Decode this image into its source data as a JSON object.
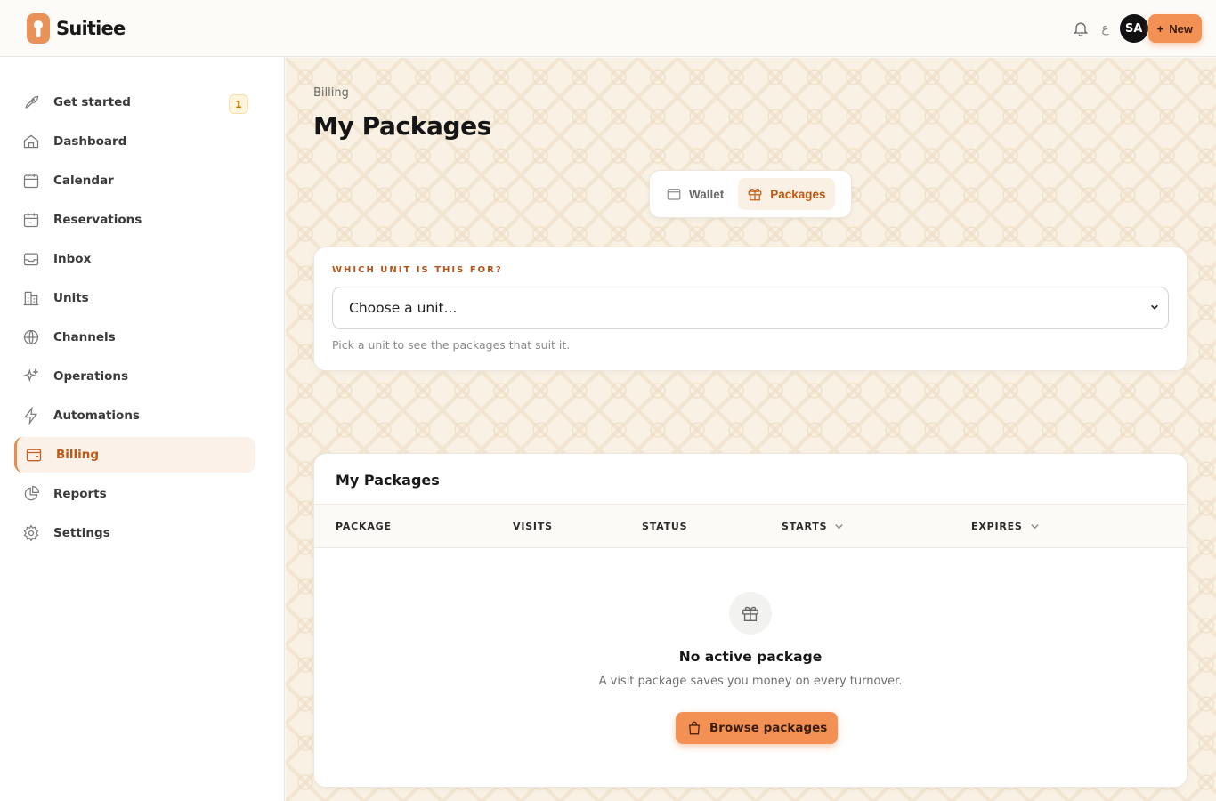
{
  "brand": {
    "name": "Suitiee",
    "accent": "#e8925a"
  },
  "header": {
    "lang_label": "ع",
    "avatar_initials": "SA",
    "new_label": "New"
  },
  "sidebar": {
    "items": [
      {
        "label": "Get started",
        "icon": "rocket-icon",
        "badge": "1"
      },
      {
        "label": "Dashboard",
        "icon": "home-icon"
      },
      {
        "label": "Calendar",
        "icon": "calendar-icon"
      },
      {
        "label": "Reservations",
        "icon": "reservations-icon"
      },
      {
        "label": "Inbox",
        "icon": "inbox-icon"
      },
      {
        "label": "Units",
        "icon": "building-icon"
      },
      {
        "label": "Channels",
        "icon": "globe-icon"
      },
      {
        "label": "Operations",
        "icon": "sparkles-icon"
      },
      {
        "label": "Automations",
        "icon": "bolt-icon"
      },
      {
        "label": "Billing",
        "icon": "wallet-icon",
        "active": true
      },
      {
        "label": "Reports",
        "icon": "pie-chart-icon"
      },
      {
        "label": "Settings",
        "icon": "gear-icon"
      }
    ]
  },
  "page": {
    "breadcrumb": "Billing",
    "title": "My Packages",
    "tabs": [
      {
        "label": "Wallet",
        "icon": "wallet-icon"
      },
      {
        "label": "Packages",
        "icon": "gift-icon",
        "active": true
      }
    ]
  },
  "unit_picker": {
    "label": "WHICH UNIT IS THIS FOR?",
    "selected": "Choose a unit...",
    "hint": "Pick a unit to see the packages that suit it."
  },
  "packages": {
    "title": "My Packages",
    "columns": [
      "PACKAGE",
      "VISITS",
      "STATUS",
      "STARTS",
      "EXPIRES"
    ],
    "empty": {
      "title": "No active package",
      "subtitle": "A visit package saves you money on every turnover.",
      "button": "Browse packages"
    }
  }
}
